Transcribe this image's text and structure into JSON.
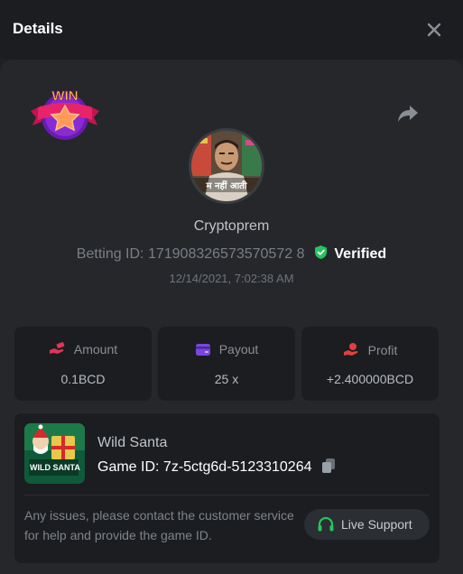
{
  "header": {
    "title": "Details"
  },
  "badge": {
    "text": "WIN"
  },
  "user": {
    "name": "Cryptoprem",
    "avatar_caption": "म नहीं आती"
  },
  "bet": {
    "id_label": "Betting ID:",
    "id_value": "171908326573570572 8",
    "verified_label": "Verified",
    "timestamp": "12/14/2021, 7:02:38 AM"
  },
  "stats": [
    {
      "label": "Amount",
      "value": "0.1BCD",
      "color": "#e0355a"
    },
    {
      "label": "Payout",
      "value": "25 x",
      "color": "#7b45e0"
    },
    {
      "label": "Profit",
      "value": "+2.400000BCD",
      "color": "#e04040"
    }
  ],
  "game": {
    "name": "Wild Santa",
    "id_label": "Game ID:",
    "id_value": "7z-5ctg6d-5123310264",
    "thumb_text": "WILD SANTA"
  },
  "help": {
    "text": "Any issues, please contact the customer service for help and provide the game ID.",
    "support_label": "Live Support"
  },
  "colors": {
    "verified": "#22c55e",
    "support_icon": "#22c55e"
  }
}
